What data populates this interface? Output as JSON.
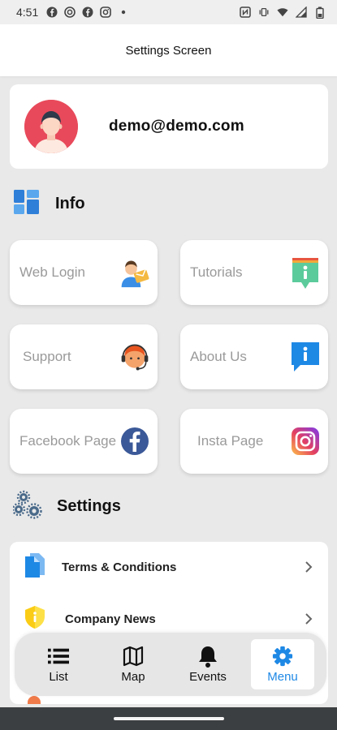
{
  "status_bar": {
    "time": "4:51",
    "left_icons": [
      "facebook-icon",
      "instagram-icon",
      "facebook-icon",
      "instagram-icon",
      "dot-icon"
    ],
    "right_icons": [
      "nfc-icon",
      "vibrate-icon",
      "wifi-icon",
      "signal-icon",
      "battery-icon"
    ]
  },
  "app_bar": {
    "title": "Settings Screen"
  },
  "profile": {
    "email": "demo@demo.com",
    "avatar_color": "#e84a5b"
  },
  "info_section": {
    "title": "Info",
    "tiles": [
      {
        "label": "Web Login",
        "icon": "web-login-icon"
      },
      {
        "label": "Tutorials",
        "icon": "tutorials-icon"
      },
      {
        "label": "Support",
        "icon": "support-agent-icon"
      },
      {
        "label": "About Us",
        "icon": "about-us-icon"
      },
      {
        "label": "Facebook Page",
        "icon": "facebook-icon"
      },
      {
        "label": "Insta Page",
        "icon": "instagram-icon"
      }
    ]
  },
  "settings_section": {
    "title": "Settings",
    "items": [
      {
        "label": "Terms & Conditions",
        "icon": "document-icon"
      },
      {
        "label": "Company News",
        "icon": "shield-icon"
      }
    ]
  },
  "bottom_nav": {
    "items": [
      {
        "label": "List",
        "icon": "list-icon",
        "active": false
      },
      {
        "label": "Map",
        "icon": "map-icon",
        "active": false
      },
      {
        "label": "Events",
        "icon": "bell-icon",
        "active": false
      },
      {
        "label": "Menu",
        "icon": "gear-icon",
        "active": true
      }
    ],
    "accent_color": "#1e88e5"
  }
}
